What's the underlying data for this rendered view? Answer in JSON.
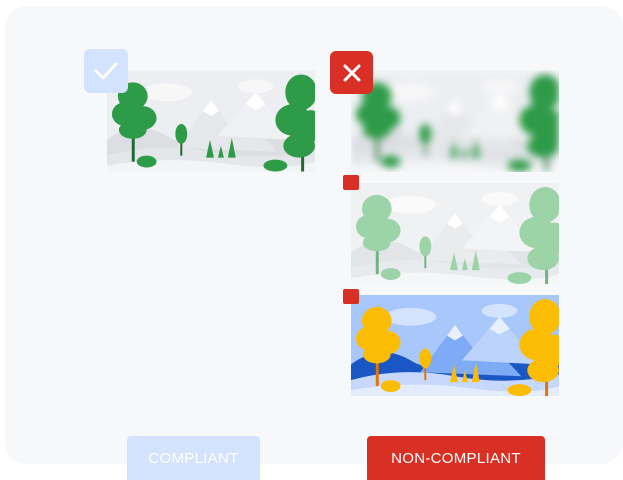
{
  "buttons": {
    "compliant_label": "COMPLIANT",
    "non_compliant_label": "NON-COMPLIANT"
  },
  "badges": {
    "compliant_icon": "check-icon",
    "non_compliant_icon": "close-icon",
    "variant_marker": "red-square-marker"
  },
  "images": {
    "compliant_example": "green-landscape-illustration",
    "non_compliant_examples": [
      "blurred-landscape-illustration",
      "washed-out-landscape-illustration",
      "recolored-blue-yellow-landscape-illustration"
    ]
  },
  "colors": {
    "panel_bg": "#f7f8fa",
    "compliant_accent": "#d3e3fd",
    "non_compliant_accent": "#d93025",
    "tree_green": "#34a853",
    "tree_yellow": "#fbbc04",
    "sky_blue": "#a8c7fa"
  }
}
